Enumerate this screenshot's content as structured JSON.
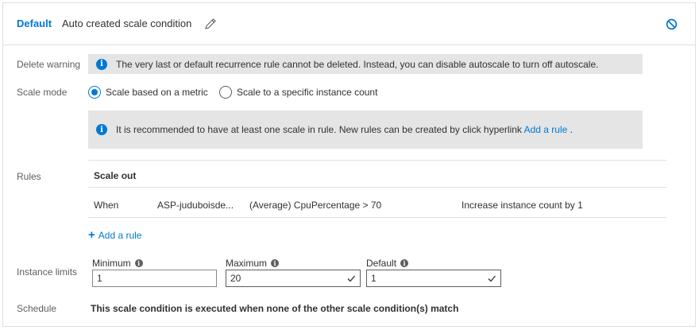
{
  "header": {
    "badge": "Default",
    "title": "Auto created scale condition"
  },
  "labels": {
    "delete_warning": "Delete warning",
    "scale_mode": "Scale mode",
    "rules": "Rules",
    "instance_limits": "Instance limits",
    "schedule": "Schedule"
  },
  "delete_warning": {
    "text": "The very last or default recurrence rule cannot be deleted. Instead, you can disable autoscale to turn off autoscale."
  },
  "scale_mode": {
    "options": [
      {
        "label": "Scale based on a metric",
        "selected": true
      },
      {
        "label": "Scale to a specific instance count",
        "selected": false
      }
    ]
  },
  "info": {
    "text": "It is recommended to have at least one scale in rule. New rules can be created by click hyperlink",
    "link": "Add a rule",
    "suffix": "."
  },
  "rules": {
    "header": "Scale out",
    "row": {
      "when": "When",
      "resource": "ASP-juduboisde...",
      "condition": "(Average) CpuPercentage > 70",
      "action": "Increase instance count by 1"
    },
    "add_link": "Add a rule"
  },
  "instance_limits": {
    "minimum": {
      "label": "Minimum",
      "value": "1"
    },
    "maximum": {
      "label": "Maximum",
      "value": "20"
    },
    "default": {
      "label": "Default",
      "value": "1"
    }
  },
  "schedule": {
    "text": "This scale condition is executed when none of the other scale condition(s) match"
  },
  "colors": {
    "accent": "#0078d4",
    "info_bg": "#e5e5e5",
    "border": "#e1dfdd"
  }
}
